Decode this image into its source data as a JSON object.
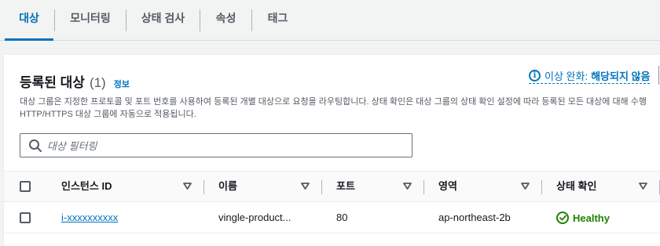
{
  "tabs": [
    {
      "label": "대상",
      "active": true
    },
    {
      "label": "모니터링",
      "active": false
    },
    {
      "label": "상태 검사",
      "active": false
    },
    {
      "label": "속성",
      "active": false
    },
    {
      "label": "태그",
      "active": false
    }
  ],
  "panel": {
    "title": "등록된 대상",
    "count": "(1)",
    "info_label": "정보",
    "anomaly": {
      "label": "이상 완화:",
      "value": "해당되지 않음"
    },
    "description_line1": "대상 그룹은 지정한 프로토콜 및 포트 번호를 사용하여 등록된 개별 대상으로 요청을 라우팅합니다. 상태 확인은 대상 그룹의 상태 확인 설정에 따라 등록된 모든 대상에 대해 수행",
    "description_line2": "HTTP/HTTPS 대상 그룹에 자동으로 적용됩니다."
  },
  "search": {
    "placeholder": "대상 필터링",
    "value": ""
  },
  "table": {
    "columns": [
      "인스턴스 ID",
      "이름",
      "포트",
      "영역",
      "상태 확인"
    ],
    "rows": [
      {
        "instance_id": "i-xxxxxxxxxx",
        "name": "vingle-product...",
        "port": "80",
        "zone": "ap-northeast-2b",
        "health": "Healthy"
      }
    ]
  },
  "colors": {
    "accent": "#0073bb",
    "healthy": "#1d8102",
    "text": "#16191f",
    "muted": "#545b64"
  }
}
